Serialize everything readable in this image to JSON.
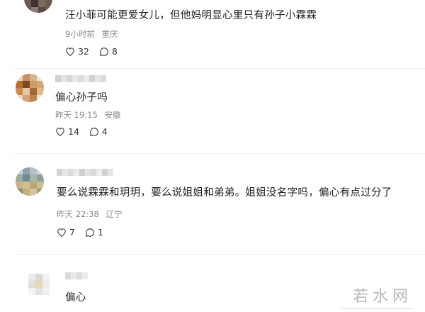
{
  "comments": [
    {
      "text": "汪小菲可能更爱女儿，但他妈明显心里只有孙子小霖霖",
      "time": "9小时前",
      "location": "重庆",
      "likes": "32",
      "replies": "8"
    },
    {
      "text": "偏心孙子吗",
      "time": "昨天 19:15",
      "location": "安徽",
      "likes": "14",
      "replies": "4"
    },
    {
      "text": "要么说霖霖和玥玥，要么说姐姐和弟弟。姐姐没名字吗，偏心有点过分了",
      "time": "昨天 22:38",
      "location": "辽宁",
      "likes": "7",
      "replies": "1"
    },
    {
      "text": "偏心"
    }
  ],
  "watermark": "若水网",
  "colors": {
    "text": "#1f1f1f",
    "meta": "#8a8a8a",
    "icon": "#444444"
  }
}
